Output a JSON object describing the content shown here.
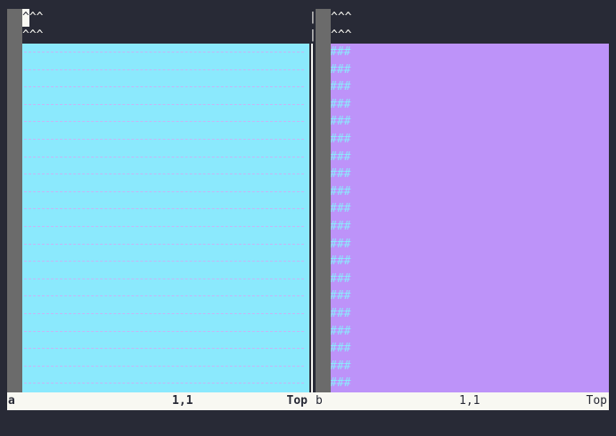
{
  "windows": {
    "a": {
      "top_lines": [
        "^^^",
        "^^^"
      ],
      "cursor_char": "^",
      "cursor_rest": "^^",
      "fill_color": "#8be9fd",
      "dash_color": "#d5a9f4",
      "status": {
        "name": "a",
        "position": "1,1",
        "scroll": "Top"
      }
    },
    "b": {
      "top_lines": [
        "^^^",
        "^^^"
      ],
      "fill_text": "###",
      "fill_color": "#bd93f9",
      "text_color": "#8be9fd",
      "status": {
        "name": "b",
        "position": "1,1",
        "scroll": "Top"
      }
    }
  },
  "separator": {
    "char": "|"
  },
  "colors": {
    "background": "#282a36",
    "sign_column": "#6b6b6b",
    "status_bg": "#f8f8f2",
    "status_fg": "#282a36"
  }
}
